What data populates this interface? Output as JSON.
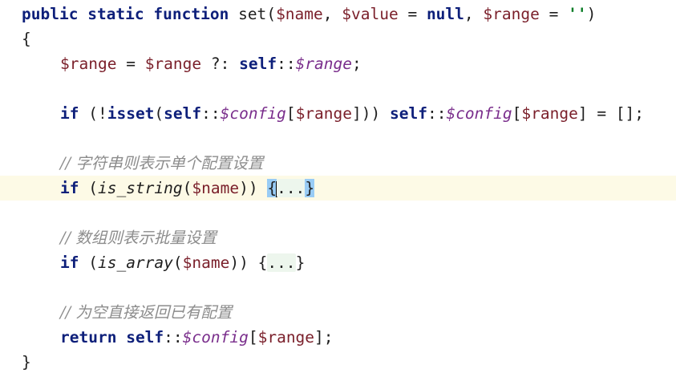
{
  "code": {
    "l1": {
      "kw_public": "public",
      "kw_static": "static",
      "kw_function": "function",
      "fn_name": "set",
      "open_paren": "(",
      "var_name": "$name",
      "comma1": ", ",
      "var_value": "$value",
      "eq1": " = ",
      "kw_null": "null",
      "comma2": ", ",
      "var_range": "$range",
      "eq2": " = ",
      "str_empty": "''",
      "close_paren": ")"
    },
    "l2": {
      "brace_open": "{"
    },
    "l3": {
      "var_range": "$range",
      "op": " = ",
      "var_range2": "$range",
      "elvis": " ?: ",
      "kw_self": "self",
      "scope": "::",
      "static_range": "$range",
      "semi": ";"
    },
    "l5": {
      "kw_if": "if",
      "paren_open": " (!",
      "kw_isset": "isset",
      "p2": "(",
      "kw_self": "self",
      "scope": "::",
      "static_config": "$config",
      "br_open": "[",
      "var_range": "$range",
      "br_close": "]))",
      "space": " ",
      "kw_self2": "self",
      "scope2": "::",
      "static_config2": "$config",
      "br_open2": "[",
      "var_range2": "$range",
      "br_close2": "]",
      "assign": " = [];"
    },
    "l7": {
      "comment": "// 字符串则表示单个配置设置"
    },
    "l8": {
      "kw_if": "if",
      "p_open": " (",
      "fn_is_string": "is_string",
      "p2": "(",
      "var_name": "$name",
      "p_close": ")) ",
      "brace_open": "{",
      "ellipsis": "...",
      "brace_close": "}"
    },
    "l10": {
      "comment": "// 数组则表示批量设置"
    },
    "l11": {
      "kw_if": "if",
      "p_open": " (",
      "fn_is_array": "is_array",
      "p2": "(",
      "var_name": "$name",
      "p_close": ")) ",
      "brace_open": "{",
      "ellipsis": "...",
      "brace_close": "}"
    },
    "l13": {
      "comment": "// 为空直接返回已有配置"
    },
    "l14": {
      "kw_return": "return",
      "space": " ",
      "kw_self": "self",
      "scope": "::",
      "static_config": "$config",
      "br_open": "[",
      "var_range": "$range",
      "br_close": "];"
    },
    "l15": {
      "brace_close": "}"
    }
  },
  "colors": {
    "keyword": "#0d1f7a",
    "variable": "#7a1f2a",
    "static_field": "#7a2e8c",
    "string": "#0a7d27",
    "comment": "#8c8c8c",
    "current_line": "#fdfae6",
    "fold_background": "#edf6ed",
    "brace_match": "#99ccf5"
  }
}
